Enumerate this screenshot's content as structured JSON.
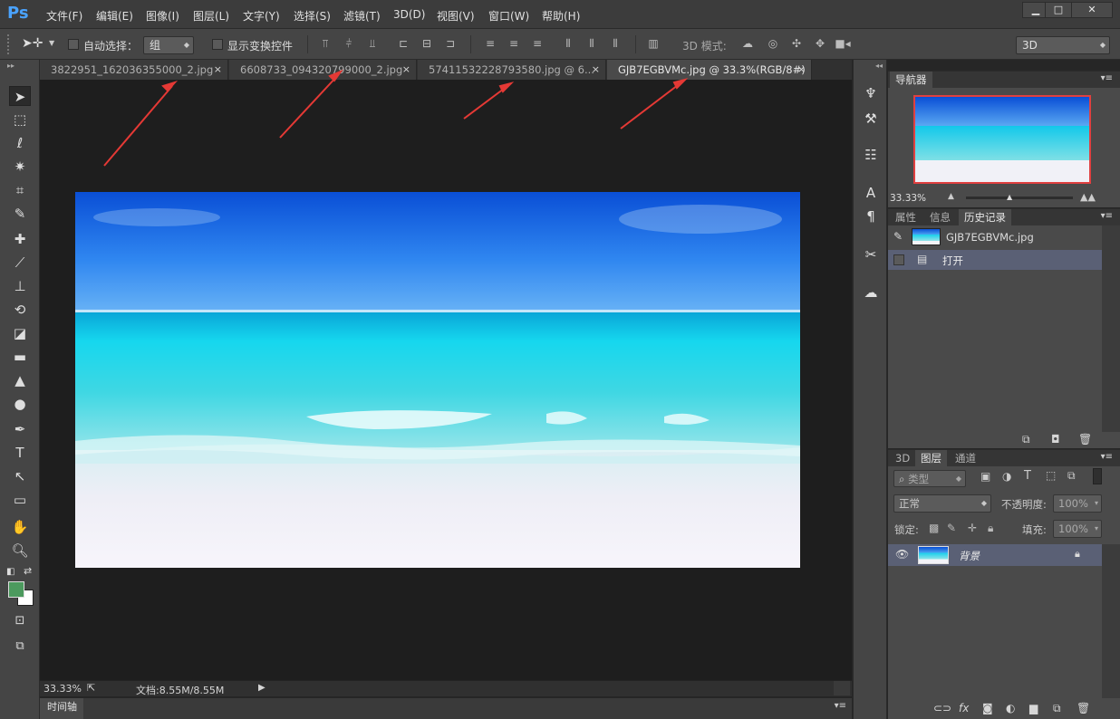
{
  "app": {
    "logo": "Ps"
  },
  "menu": [
    "文件(F)",
    "编辑(E)",
    "图像(I)",
    "图层(L)",
    "文字(Y)",
    "选择(S)",
    "滤镜(T)",
    "3D(D)",
    "视图(V)",
    "窗口(W)",
    "帮助(H)"
  ],
  "window_buttons": {
    "minimize": "▁",
    "maximize": "□",
    "close": "✕"
  },
  "options": {
    "auto_select_label": "自动选择：",
    "auto_select_value": "组",
    "show_transform_label": "显示变换控件",
    "mode_3d_label": "3D 模式:",
    "workspace_value": "3D"
  },
  "tabs": [
    {
      "label": "3822951_162036355000_2.jpg",
      "close": "×"
    },
    {
      "label": "6608733_094320799000_2.jpg",
      "close": "×"
    },
    {
      "label": "57411532228793580.jpg @ 6...",
      "close": "×"
    },
    {
      "label": "GJB7EGBVMc.jpg @ 33.3%(RGB/8#)",
      "close": "×"
    }
  ],
  "status": {
    "zoom": "33.33%",
    "doc_info": "文档:8.55M/8.55M"
  },
  "timeline": {
    "label": "时间轴"
  },
  "navigator": {
    "tab": "导航器",
    "zoom": "33.33%"
  },
  "history_panel": {
    "tabs": [
      "属性",
      "信息",
      "历史记录"
    ],
    "snapshot": "GJB7EGBVMc.jpg",
    "steps": [
      "打开"
    ]
  },
  "layers_panel": {
    "tabs": [
      "3D",
      "图层",
      "通道"
    ],
    "filter_label": "类型",
    "blend_mode": "正常",
    "opacity_label": "不透明度:",
    "opacity_value": "100%",
    "lock_label": "锁定:",
    "fill_label": "填充:",
    "fill_value": "100%",
    "layers": [
      {
        "name": "背景"
      }
    ]
  },
  "colors": {
    "foreground": "#4c9a5e",
    "background": "#ffffff",
    "accent_frame": "#e04040"
  }
}
